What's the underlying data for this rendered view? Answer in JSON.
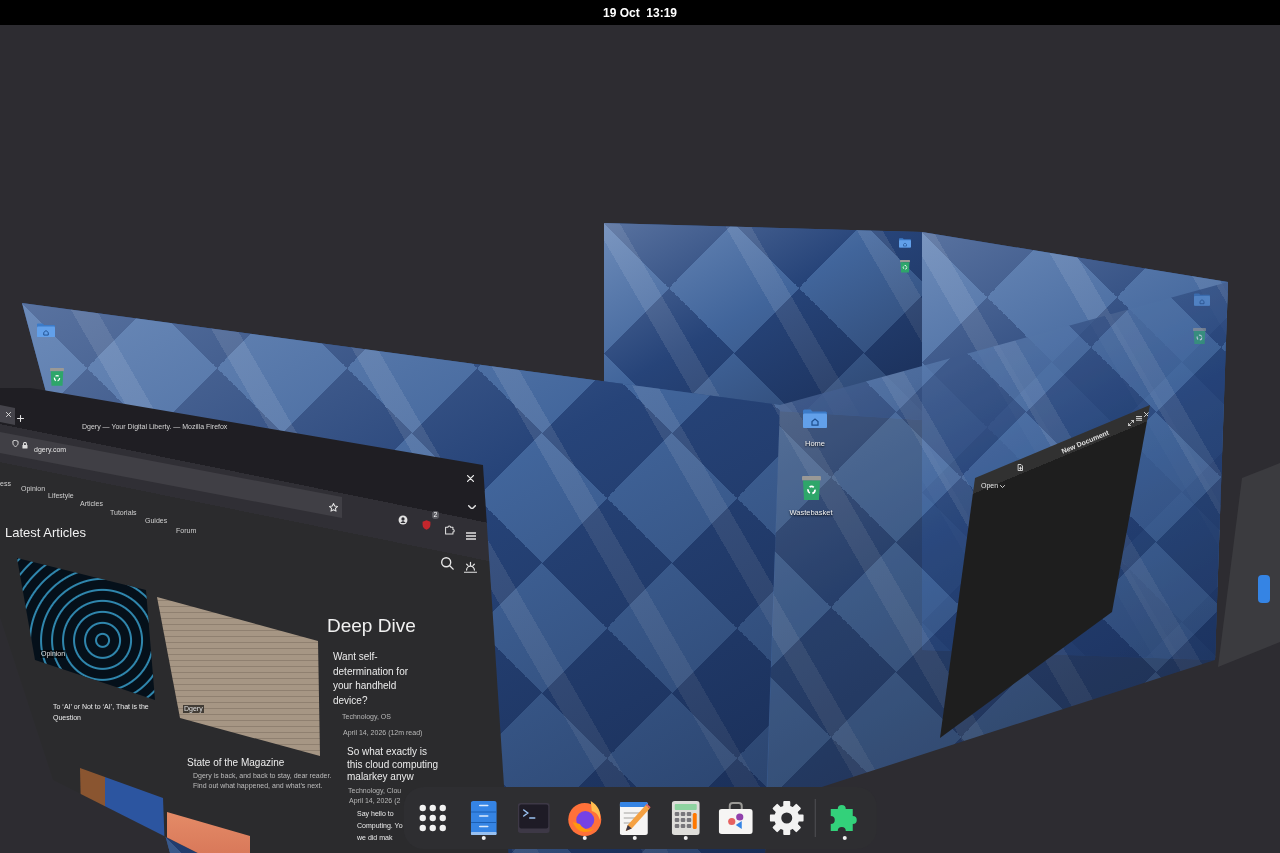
{
  "top_bar": {
    "clock": "19 Oct  13:19"
  },
  "workspaces": [
    {
      "desktop_icons": [
        {
          "kind": "home-folder"
        },
        {
          "kind": "recycle-bin"
        }
      ]
    },
    {
      "desktop_icons": [
        {
          "kind": "home-folder"
        },
        {
          "kind": "recycle-bin"
        }
      ]
    },
    {
      "desktop_icons": [
        {
          "kind": "home-folder"
        },
        {
          "kind": "recycle-bin"
        }
      ]
    },
    {
      "desktop_icons": [
        {
          "kind": "home-folder",
          "label": "Home"
        },
        {
          "kind": "recycle-bin",
          "label": "Wastebasket"
        }
      ]
    }
  ],
  "browser_window": {
    "title": "Dgery — Your Digital Liberty. — Mozilla Firefox",
    "tabs": [
      {
        "selected": true
      }
    ],
    "url": "dgery.com",
    "blocker_badge": "2",
    "site_nav": [
      "ess",
      "Opinion",
      "Lifestyle",
      "Articles",
      "Tutorials",
      "Guides",
      "Forum"
    ],
    "section_title": "Latest Articles",
    "articles": [
      {
        "kind": "story",
        "category": "Opinion",
        "title": "To ‘AI’ or Not to ‘AI’, That is the Question"
      },
      {
        "kind": "story",
        "category": "Dgery",
        "title": "State of the Magazine",
        "summary": "Dgery is back, and back to stay, dear reader. Find out what happened, and what’s next."
      },
      {
        "kind": "photo"
      },
      {
        "kind": "photo"
      }
    ],
    "deep_dive": {
      "title": "Deep Dive",
      "items": [
        {
          "title_lines": [
            "Want self-",
            "determination for",
            "your handheld",
            "device?"
          ],
          "category": "Technology, OS",
          "date": "April 14, 2026 (12m read)"
        },
        {
          "title_lines": [
            "So what exactly is",
            "this cloud computing",
            "malarkey anyw"
          ],
          "category": "Technology, Clou",
          "date": "April 14, 2026 (2"
        },
        {
          "title_lines": [
            "Say hello to",
            "Computing. Yo",
            "we did mak"
          ]
        }
      ]
    }
  },
  "editor_window": {
    "open_button": "Open",
    "title": "New Document"
  },
  "dock": {
    "apps": [
      {
        "kind": "app-grid",
        "running": false
      },
      {
        "kind": "files",
        "running": true
      },
      {
        "kind": "terminal",
        "running": false
      },
      {
        "kind": "browser",
        "running": true
      },
      {
        "kind": "text-editor",
        "running": true
      },
      {
        "kind": "calculator",
        "running": true
      },
      {
        "kind": "software",
        "running": false
      },
      {
        "kind": "settings",
        "running": false
      },
      {
        "kind": "separator"
      },
      {
        "kind": "extensions",
        "running": true
      }
    ]
  }
}
